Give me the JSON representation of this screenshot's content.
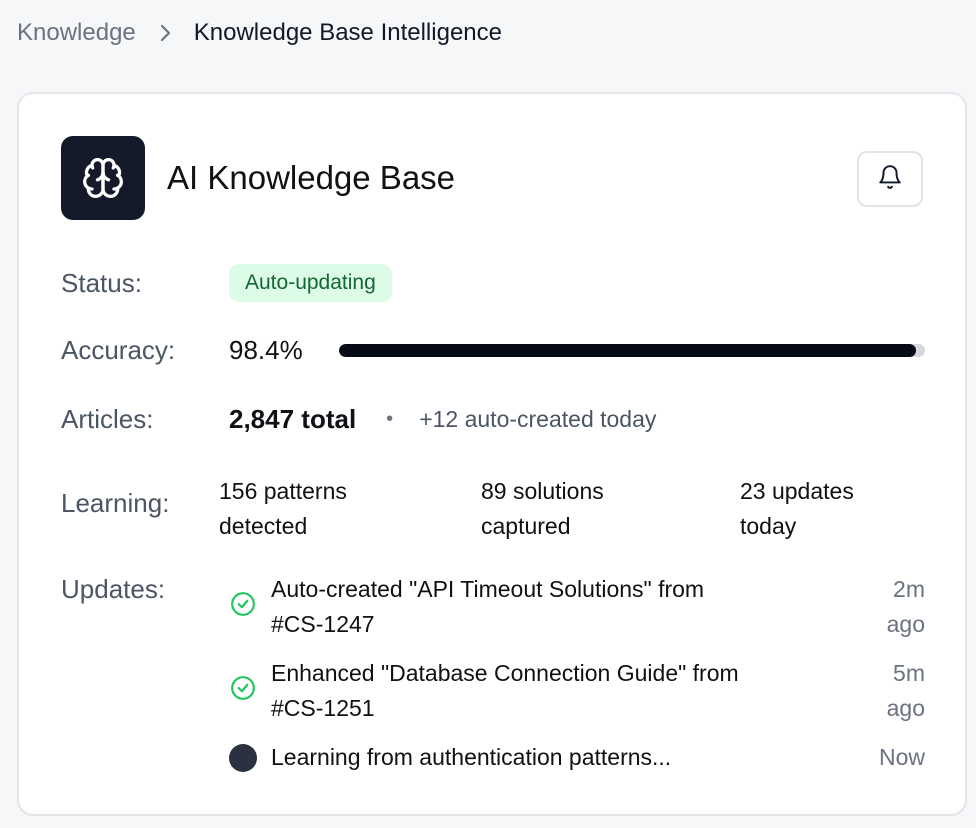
{
  "breadcrumb": {
    "root": "Knowledge",
    "current": "Knowledge Base Intelligence",
    "separator_icon": "chevron-right-icon"
  },
  "card": {
    "title": "AI Knowledge Base",
    "logo_icon": "brain-icon",
    "notification_icon": "bell-icon",
    "status": {
      "label": "Status:",
      "value": "Auto-updating",
      "badge_color": "#dcfce7",
      "badge_text_color": "#166534"
    },
    "accuracy": {
      "label": "Accuracy:",
      "value": "98.4%",
      "fraction": 0.984
    },
    "articles": {
      "label": "Articles:",
      "total": "2,847 total",
      "separator": "•",
      "auto_created": "+12 auto-created today"
    },
    "learning": {
      "label": "Learning:",
      "stats": [
        {
          "line1": "156 patterns",
          "line2": "detected"
        },
        {
          "line1": "89 solutions",
          "line2": "captured"
        },
        {
          "line1": "23 updates",
          "line2": "today"
        }
      ]
    },
    "updates": {
      "label": "Updates:",
      "items": [
        {
          "icon": "check-circle-icon",
          "line1": "Auto-created \"API Timeout Solutions\" from",
          "line2": "#CS-1247",
          "time1": "2m",
          "time2": "ago"
        },
        {
          "icon": "check-circle-icon",
          "line1": "Enhanced \"Database Connection Guide\" from",
          "line2": "#CS-1251",
          "time1": "5m",
          "time2": "ago"
        },
        {
          "icon": "in-progress-dot-icon",
          "line1": "Learning from authentication patterns...",
          "time1": "Now"
        }
      ]
    }
  },
  "colors": {
    "accent_dark": "#141a29",
    "success": "#22c55e",
    "progress_fill": "#070b18"
  }
}
